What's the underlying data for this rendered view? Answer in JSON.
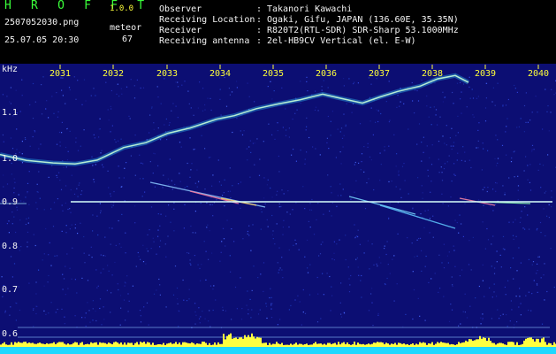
{
  "header": {
    "app_title": "H R O F F T",
    "app_version": "1.0.0",
    "file_name": "2507052030.png",
    "timestamp": "25.07.05 20:30",
    "meteor_label": "meteor",
    "meteor_count": "67",
    "info": [
      {
        "label": "Observer",
        "sep": ":",
        "value": "Takanori Kawachi"
      },
      {
        "label": "Receiving Location",
        "sep": ":",
        "value": "Ogaki, Gifu, JAPAN (136.60E, 35.35N)"
      },
      {
        "label": "Receiver",
        "sep": ":",
        "value": "R820T2(RTL-SDR) SDR-Sharp 53.1000MHz"
      },
      {
        "label": "Receiving antenna",
        "sep": ":",
        "value": "2el-HB9CV Vertical (el. E-W)"
      }
    ]
  },
  "spectrogram": {
    "y_unit": "kHz",
    "y_ticks": [
      {
        "value": 1.1,
        "label": "1.1"
      },
      {
        "value": 1.0,
        "label": "1.0"
      },
      {
        "value": 0.9,
        "label": "0.9"
      },
      {
        "value": 0.8,
        "label": "0.8"
      },
      {
        "value": 0.7,
        "label": "0.7"
      },
      {
        "value": 0.6,
        "label": "0.6"
      }
    ],
    "x_ticks": [
      "2031",
      "2032",
      "2033",
      "2034",
      "2035",
      "2036",
      "2037",
      "2038",
      "2039",
      "2040"
    ],
    "colors": {
      "background": "#0c0e73",
      "tick": "#ffff3a",
      "trace": "#8cf0ff",
      "carrier": "#d8fffb",
      "meter": "#ffff40",
      "meter_base": "#1fd8ff"
    }
  }
}
